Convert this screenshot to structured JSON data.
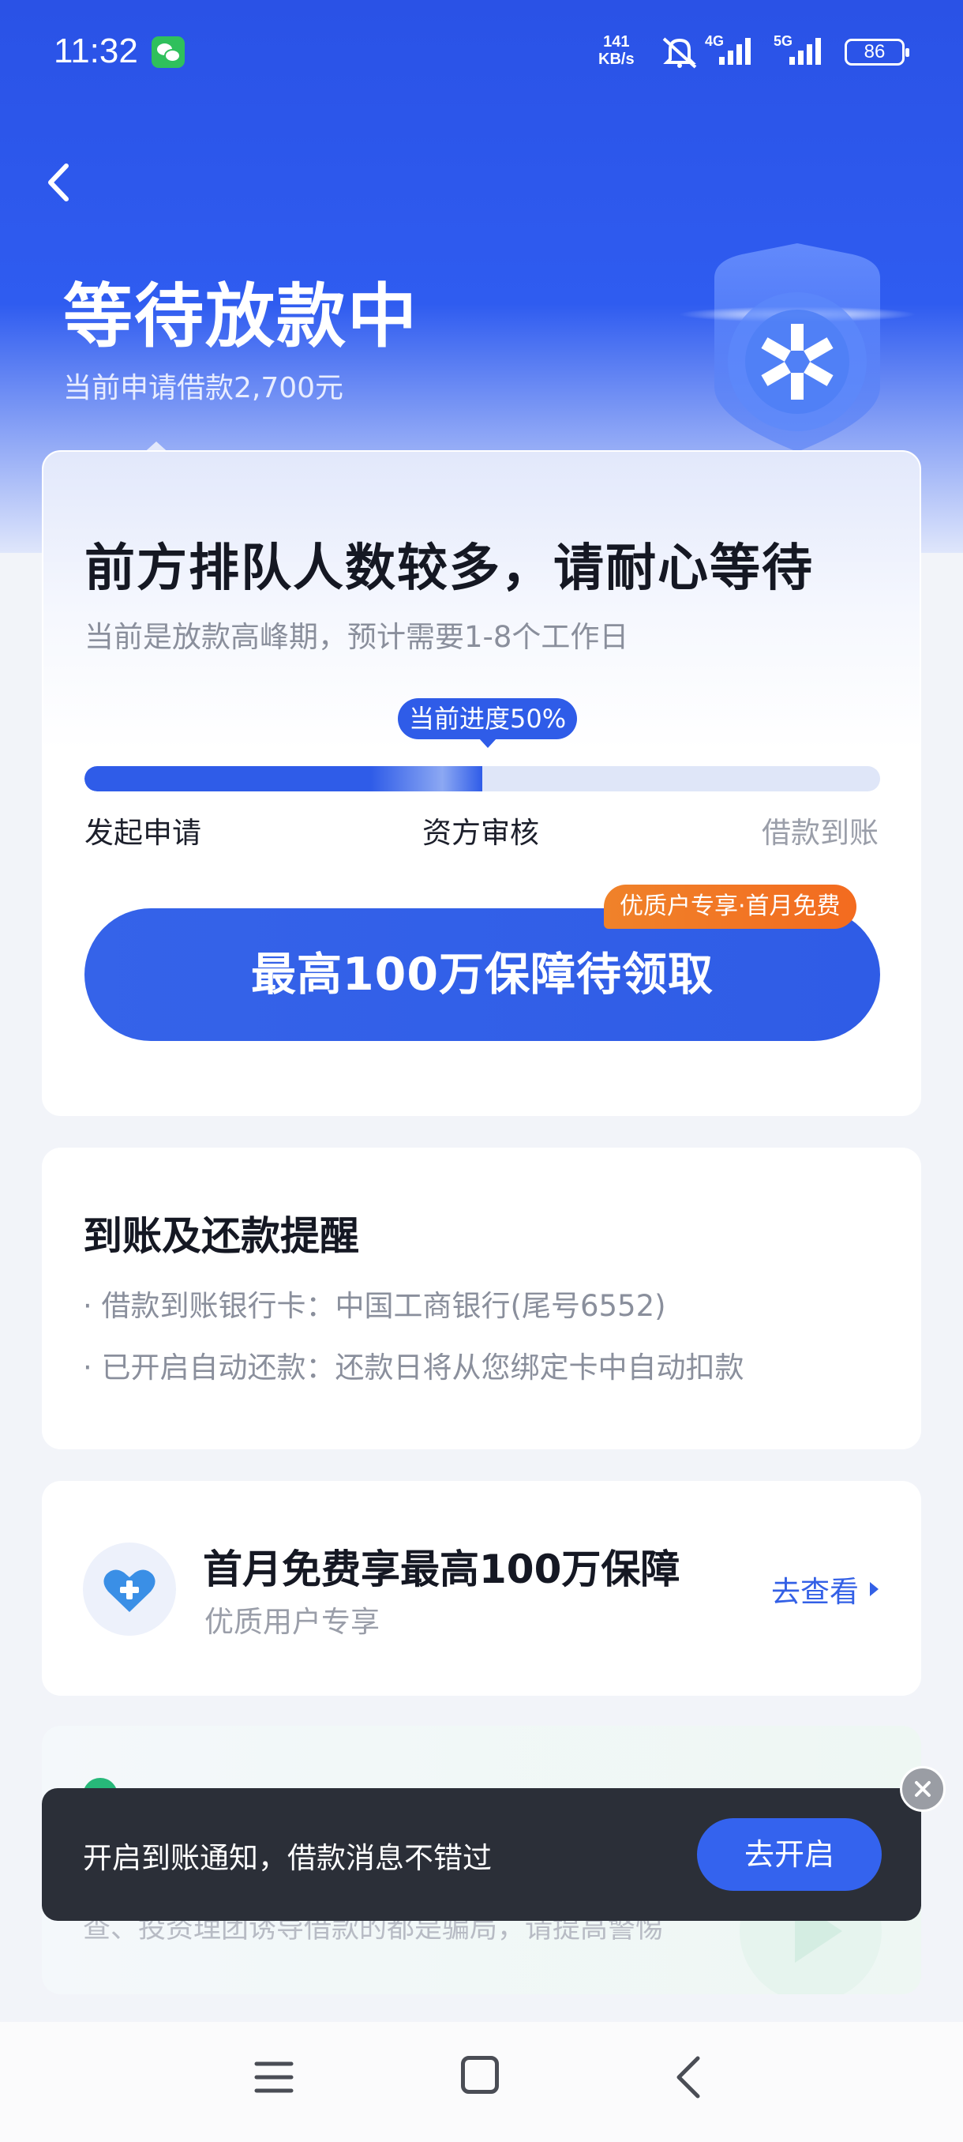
{
  "status_bar": {
    "time": "11:32",
    "net_speed_value": "141",
    "net_speed_unit": "KB/s",
    "signal_1_label": "4G",
    "signal_2_label": "5G",
    "battery": "86",
    "icons": [
      "wechat-icon",
      "mute-icon",
      "signal-icon",
      "battery-icon"
    ]
  },
  "header": {
    "title": "等待放款中",
    "subtitle": "当前申请借款2,700元"
  },
  "progress_card": {
    "title": "前方排队人数较多，请耐心等待",
    "subtitle": "当前是放款高峰期，预计需要1-8个工作日",
    "progress_tip": "当前进度50%",
    "progress_fraction": 0.5,
    "steps": [
      "发起申请",
      "资方审核",
      "借款到账"
    ],
    "cta_label": "最高100万保障待领取",
    "promo_badge": "优质户专享·首月免费"
  },
  "reminder_card": {
    "title": "到账及还款提醒",
    "items": [
      "· 借款到账银行卡：中国工商银行(尾号6552)",
      "· 已开启自动还款：还款日将从您绑定卡中自动扣款"
    ]
  },
  "guarantee_card": {
    "title": "首月免费享最高100万保障",
    "subtitle": "优质用户专享",
    "link_label": "去查看"
  },
  "warning_card": {
    "text": "查、投资理团诱导借款的都是骗局，请提高警惕"
  },
  "toast": {
    "text": "开启到账通知，借款消息不错过",
    "button_label": "去开启"
  },
  "colors": {
    "brand_blue": "#2f5ce8",
    "promo_orange": "#f0822a",
    "toast_bg": "#2b2f38"
  }
}
